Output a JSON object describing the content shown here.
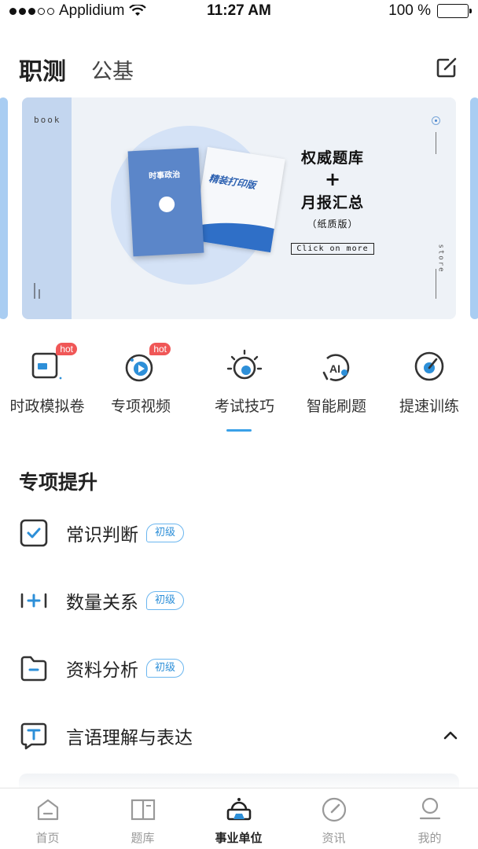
{
  "status_bar": {
    "carrier": "Applidium",
    "time": "11:27 AM",
    "battery": "100 %"
  },
  "header": {
    "tab_active": "职测",
    "tab_inactive": "公基"
  },
  "banner": {
    "side_label": "book",
    "cover_title": "时事政治",
    "back_title": "精装打印版",
    "line1": "权威题库",
    "plus": "+",
    "line2": "月报汇总",
    "note": "（纸质版）",
    "button": "Click on more",
    "side_word": "store"
  },
  "shortcuts": [
    {
      "label": "时政模拟卷",
      "badge": "hot"
    },
    {
      "label": "专项视频",
      "badge": "hot"
    },
    {
      "label": "考试技巧",
      "badge": ""
    },
    {
      "label": "智能刷题",
      "badge": ""
    },
    {
      "label": "提速训练",
      "badge": ""
    }
  ],
  "section": {
    "title": "专项提升",
    "topics": [
      {
        "label": "常识判断",
        "level": "初级"
      },
      {
        "label": "数量关系",
        "level": "初级"
      },
      {
        "label": "资料分析",
        "level": "初级"
      },
      {
        "label": "言语理解与表达",
        "level": ""
      }
    ]
  },
  "tabbar": [
    {
      "label": "首页",
      "active": false
    },
    {
      "label": "题库",
      "active": false
    },
    {
      "label": "事业单位",
      "active": true
    },
    {
      "label": "资讯",
      "active": false
    },
    {
      "label": "我的",
      "active": false
    }
  ],
  "colors": {
    "accent": "#2d8fd8",
    "hot": "#f05757",
    "banner_bg": "#eef2f7"
  }
}
